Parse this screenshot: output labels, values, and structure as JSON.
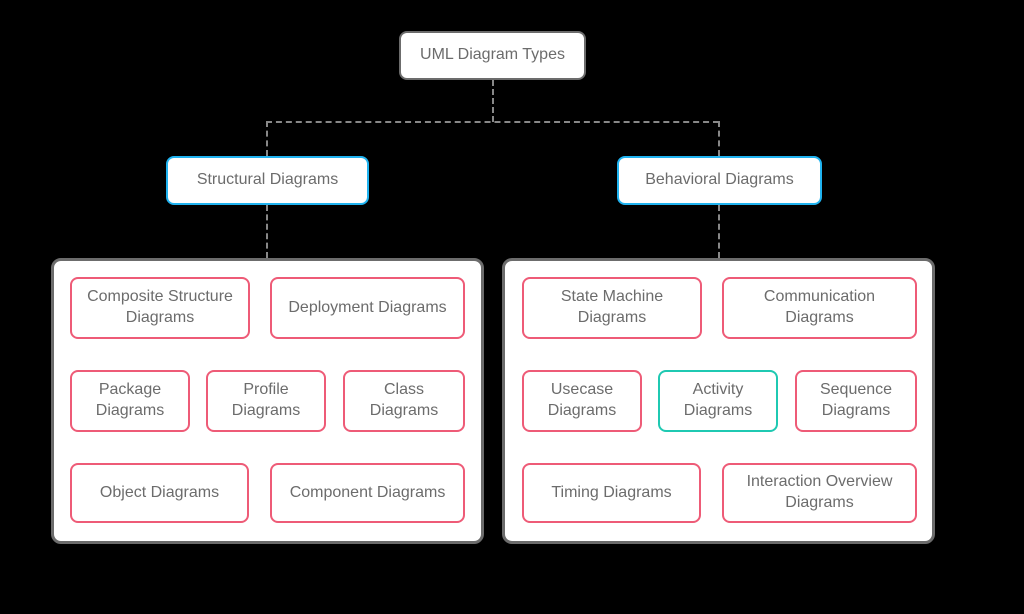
{
  "root": {
    "label": "UML Diagram Types"
  },
  "categories": {
    "structural": {
      "label": "Structural Diagrams"
    },
    "behavioral": {
      "label": "Behavioral Diagrams"
    }
  },
  "structural_leaves": {
    "composite": "Composite Structure Diagrams",
    "deployment": "Deployment Diagrams",
    "package": "Package Diagrams",
    "profile": "Profile Diagrams",
    "class": "Class Diagrams",
    "object": "Object Diagrams",
    "component": "Component Diagrams"
  },
  "behavioral_leaves": {
    "statemachine": "State Machine Diagrams",
    "communication": "Communication Diagrams",
    "usecase": "Usecase Diagrams",
    "activity": "Activity Diagrams",
    "sequence": "Sequence Diagrams",
    "timing": "Timing Diagrams",
    "interactionoverview": "Interaction Overview Diagrams"
  },
  "colors": {
    "root_border": "#6c6c6c",
    "category_border": "#20b3f0",
    "leaf_pink": "#ee5b77",
    "leaf_teal": "#1fc9b2",
    "text": "#6c6c6c",
    "connector": "#888"
  }
}
